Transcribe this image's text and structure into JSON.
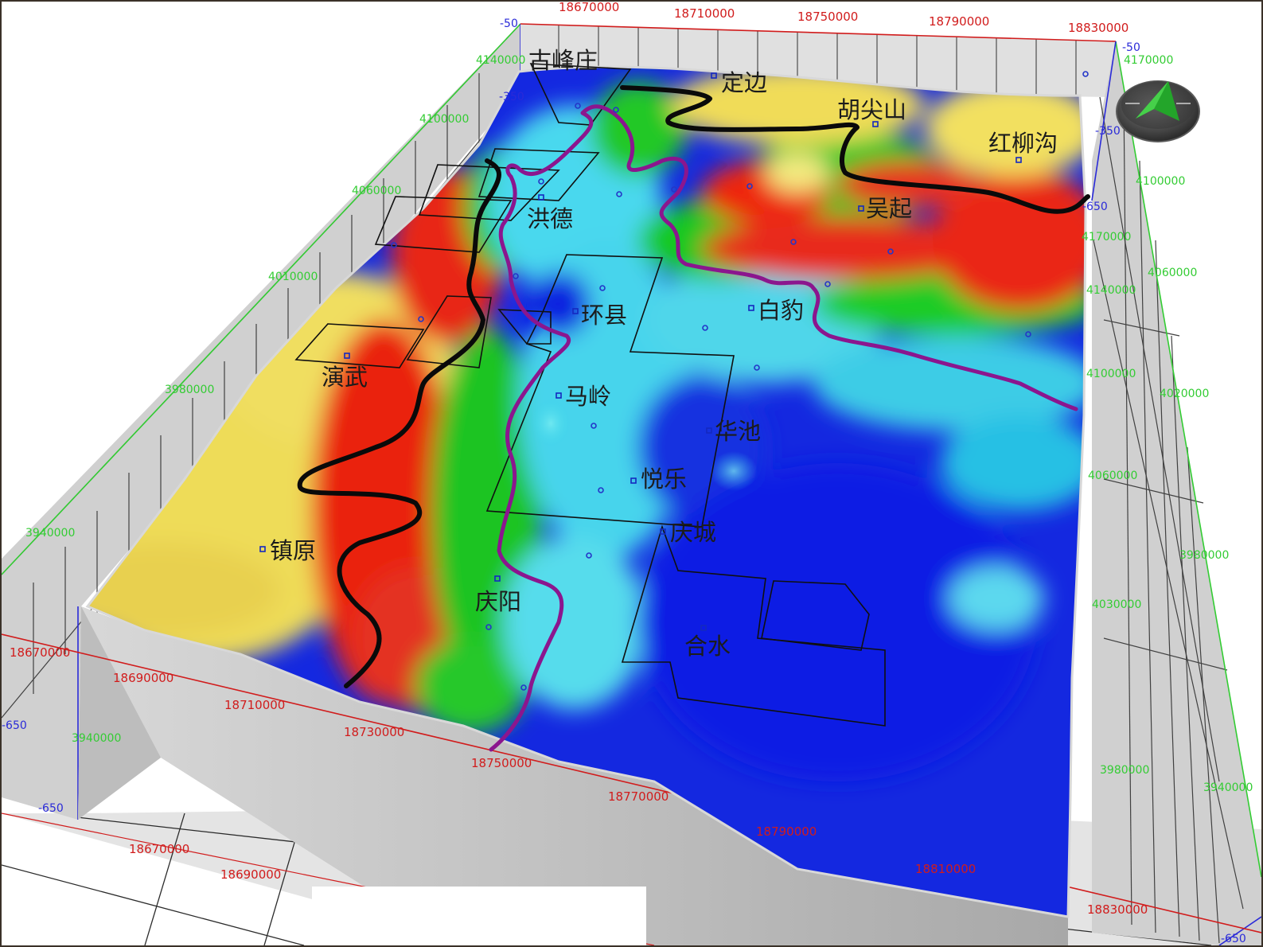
{
  "colors": {
    "axis_red": "#d11c1c",
    "axis_green": "#33cc33",
    "axis_blue": "#2a2ad8",
    "boundary_black": "#0a0a0a",
    "boundary_purple": "#8b168e",
    "well_marker": "#2436c8"
  },
  "axes": {
    "x_top": [
      "18670000",
      "18710000",
      "18750000",
      "18790000",
      "18830000"
    ],
    "x_front": [
      "18670000",
      "18690000",
      "18710000",
      "18730000",
      "18750000",
      "18770000",
      "18790000",
      "18810000",
      "18830000"
    ],
    "x_floor": [
      "18670000",
      "18690000"
    ],
    "y_left": [
      "4140000",
      "4100000",
      "4060000",
      "4010000",
      "3980000",
      "3940000",
      "3940000"
    ],
    "y_right": [
      "4170000",
      "4100000",
      "4060000",
      "4020000",
      "3980000",
      "3940000"
    ],
    "y_right_inner": [
      "4170000",
      "4140000",
      "4100000",
      "4060000",
      "4030000",
      "3980000"
    ],
    "z_left": [
      "-50",
      "-350",
      "-650",
      "-650"
    ],
    "z_right": [
      "-50",
      "-350",
      "-650",
      "-650"
    ]
  },
  "places": [
    "古峰庄",
    "定边",
    "胡尖山",
    "红柳沟",
    "吴起",
    "洪德",
    "环县",
    "白豹",
    "演武",
    "马岭",
    "华池",
    "悦乐",
    "庆城",
    "镇原",
    "庆阳",
    "合水"
  ],
  "compass_icon": "north-arrow"
}
